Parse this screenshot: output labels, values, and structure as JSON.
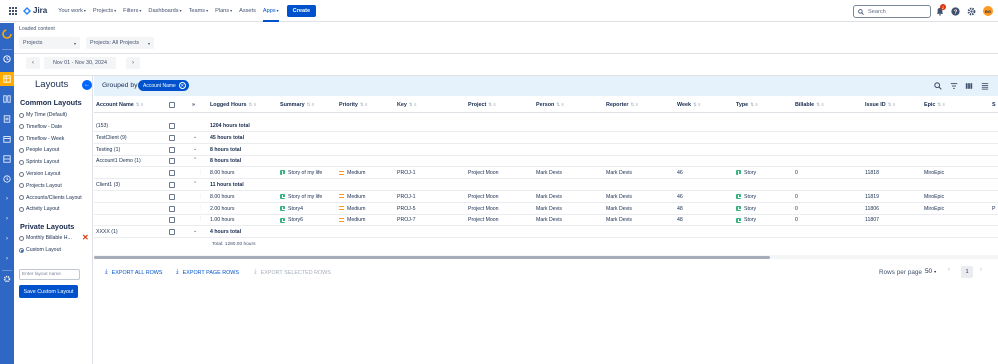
{
  "topbar": {
    "brand": "Jira",
    "nav": [
      {
        "label": "Your work",
        "chevron": true
      },
      {
        "label": "Projects",
        "chevron": true
      },
      {
        "label": "Filters",
        "chevron": true
      },
      {
        "label": "Dashboards",
        "chevron": true
      },
      {
        "label": "Teams",
        "chevron": true
      },
      {
        "label": "Plans",
        "chevron": true
      },
      {
        "label": "Assets",
        "chevron": false
      },
      {
        "label": "Apps",
        "chevron": true,
        "active": true
      }
    ],
    "create_label": "Create",
    "search_placeholder": "Search",
    "notifications_count": "2",
    "avatar_initials": "BG"
  },
  "toolbar": {
    "loaded_label": "Loaded content",
    "projects_dropdown": "Projects",
    "projects_filter": "Projects: All Projects",
    "date_range": "Nov 01 - Nov 30, 2024",
    "prev_symbol": "‹",
    "next_symbol": "›"
  },
  "layouts": {
    "title": "Layouts",
    "common_heading": "Common Layouts",
    "common": [
      {
        "label": "My Time (Default)"
      },
      {
        "label": "Timeflow - Date"
      },
      {
        "label": "Timeflow - Week"
      },
      {
        "label": "People Layout"
      },
      {
        "label": "Sprints Layout"
      },
      {
        "label": "Version Layout"
      },
      {
        "label": "Projects Layout"
      },
      {
        "label": "Accounts/Clients Layout"
      },
      {
        "label": "Activity Layout"
      }
    ],
    "private_heading": "Private Layouts",
    "private": [
      {
        "label": "Monthly Billable H...",
        "selected": false
      },
      {
        "label": "Custom Layout",
        "selected": true
      }
    ],
    "input_placeholder": "Enter layout name",
    "save_label": "Save Custom Layout"
  },
  "grouping": {
    "label": "Grouped by",
    "chip": "Account Name"
  },
  "table": {
    "columns": [
      "Account Name",
      "Logged Hours",
      "Summary",
      "Priority",
      "Key",
      "Project",
      "Person",
      "Reporter",
      "Week",
      "Type",
      "Billable",
      "Issue ID",
      "Epic",
      "S"
    ],
    "rows": [
      {
        "kind": "group",
        "account": "(153)",
        "hours": "1204 hours total",
        "toggle": ""
      },
      {
        "kind": "group",
        "account": "TestClient (9)",
        "hours": "45 hours total",
        "toggle": "⌄"
      },
      {
        "kind": "group",
        "account": "Testing (1)",
        "hours": "8 hours total",
        "toggle": "⌄"
      },
      {
        "kind": "group",
        "account": "Account1 Demo (1)",
        "hours": "8 hours total",
        "toggle": "⌃"
      },
      {
        "kind": "item",
        "hours": "8.00 hours",
        "summary": "Story of my life",
        "priority": "Medium",
        "key": "PROJ-1",
        "project": "Project Moon",
        "person": "Mark Devis",
        "reporter": "Mark Devis",
        "week": "46",
        "type": "Story",
        "billable": "0",
        "issue_id": "11818",
        "epic": "MiroEpic",
        "s": ""
      },
      {
        "kind": "group",
        "account": "Client1 (3)",
        "hours": "11 hours total",
        "toggle": "⌃"
      },
      {
        "kind": "item",
        "hours": "8.00 hours",
        "summary": "Story of my life",
        "priority": "Medium",
        "key": "PROJ-1",
        "project": "Project Moon",
        "person": "Mark Devis",
        "reporter": "Mark Devis",
        "week": "46",
        "type": "Story",
        "billable": "0",
        "issue_id": "11819",
        "epic": "MiroEpic",
        "s": ""
      },
      {
        "kind": "item",
        "hours": "2.00 hours",
        "summary": "Story4",
        "priority": "Medium",
        "key": "PROJ-5",
        "project": "Project Moon",
        "person": "Mark Devis",
        "reporter": "Mark Devis",
        "week": "48",
        "type": "Story",
        "billable": "0",
        "issue_id": "11806",
        "epic": "MiroEpic",
        "s": "P"
      },
      {
        "kind": "item",
        "hours": "1.00 hours",
        "summary": "Story6",
        "priority": "Medium",
        "key": "PROJ-7",
        "project": "Project Moon",
        "person": "Mark Devis",
        "reporter": "Mark Devis",
        "week": "48",
        "type": "Story",
        "billable": "0",
        "issue_id": "11807",
        "epic": "",
        "s": ""
      },
      {
        "kind": "group",
        "account": "XXXX (1)",
        "hours": "4 hours total",
        "toggle": "⌄"
      }
    ],
    "grand_total": "Total: 1280.00 hours"
  },
  "footer": {
    "export_all": "EXPORT ALL ROWS",
    "export_page": "EXPORT PAGE ROWS",
    "export_selected": "EXPORT SELECTED ROWS",
    "rows_per_page_label": "Rows per page",
    "rows_per_page": "50",
    "current_page": "1"
  }
}
